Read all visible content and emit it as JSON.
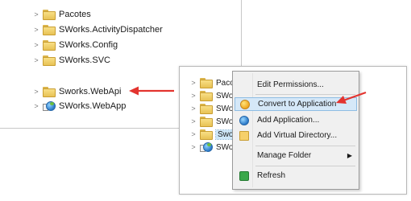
{
  "left_tree": {
    "items": [
      {
        "label": "Pacotes",
        "icon": "folder-icon"
      },
      {
        "label": "SWorks.ActivityDispatcher",
        "icon": "folder-icon"
      },
      {
        "label": "SWorks.Config",
        "icon": "folder-icon"
      },
      {
        "label": "SWorks.SVC",
        "icon": "folder-icon"
      },
      {
        "label": "Sworks.WebApi",
        "icon": "folder-icon"
      },
      {
        "label": "SWorks.WebApp",
        "icon": "globe-app-icon"
      }
    ]
  },
  "right_tree": {
    "items": [
      {
        "label": "Pacot",
        "icon": "folder-icon"
      },
      {
        "label": "SWor",
        "icon": "folder-icon"
      },
      {
        "label": "SWor",
        "icon": "folder-icon"
      },
      {
        "label": "SWor",
        "icon": "folder-icon"
      },
      {
        "label": "Swor",
        "icon": "folder-icon",
        "selected": true
      },
      {
        "label": "SWor",
        "icon": "globe-app-icon"
      }
    ]
  },
  "context_menu": {
    "items": [
      {
        "label": "Edit Permissions..."
      },
      {
        "label": "Convert to Application",
        "icon": "convert-icon",
        "highlighted": true
      },
      {
        "label": "Add Application...",
        "icon": "add-app-icon"
      },
      {
        "label": "Add Virtual Directory...",
        "icon": "virtual-directory-icon"
      },
      {
        "label": "Manage Folder",
        "submenu": true
      },
      {
        "label": "Refresh",
        "icon": "refresh-icon"
      }
    ]
  },
  "annotation_color": "#e3342f",
  "selection_color": "#cde6f7",
  "highlight_color": "#d5e8f8"
}
